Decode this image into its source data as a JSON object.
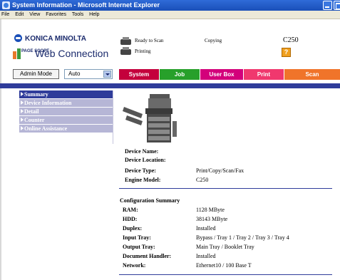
{
  "window": {
    "title": "System Information - Microsoft Internet Explorer"
  },
  "menu": [
    "File",
    "Edit",
    "View",
    "Favorites",
    "Tools",
    "Help"
  ],
  "header": {
    "brand": "KONICA MINOLTA",
    "pagescope_mark": "PAGE SCOPE",
    "product": "Web Connection",
    "status_scan": "Ready to Scan",
    "status_print": "Printing",
    "status_copy": "Copying",
    "model": "C250",
    "warning_glyph": "?"
  },
  "mode": {
    "button_label": "Admin Mode",
    "select_value": "Auto"
  },
  "tabs": [
    "System",
    "Job",
    "User Box",
    "Print",
    "Scan"
  ],
  "sidebar": [
    {
      "label": "Summary",
      "active": true
    },
    {
      "label": "Device Information",
      "active": false
    },
    {
      "label": "Detail",
      "active": false
    },
    {
      "label": "Counter",
      "active": false
    },
    {
      "label": "Online Assistance",
      "active": false
    }
  ],
  "device": {
    "name_label": "Device Name:",
    "name_value": "",
    "location_label": "Device Location:",
    "location_value": "",
    "type_label": "Device Type:",
    "type_value": "Print/Copy/Scan/Fax",
    "engine_label": "Engine Model:",
    "engine_value": "C250"
  },
  "config": {
    "heading": "Configuration Summary",
    "rows": [
      {
        "label": "RAM:",
        "value": "1128 MByte"
      },
      {
        "label": "HDD:",
        "value": "38143 MByte"
      },
      {
        "label": "Duplex:",
        "value": "Installed"
      },
      {
        "label": "Input Tray:",
        "value": "Bypass / Tray 1 / Tray 2 / Tray 3 / Tray 4"
      },
      {
        "label": "Output Tray:",
        "value": "Main Tray / Booklet Tray"
      },
      {
        "label": "Document Handler:",
        "value": "Installed"
      },
      {
        "label": "Network:",
        "value": "Ethernet10 / 100 Base T"
      }
    ]
  },
  "colors": {
    "titlebar": "#1a4fb8",
    "nav_blue": "#2f3c9a",
    "tab_system": "#c4003c",
    "tab_job": "#27a02a",
    "tab_userbox": "#d3007b",
    "tab_print": "#f0386e",
    "tab_scan": "#f0742a"
  }
}
